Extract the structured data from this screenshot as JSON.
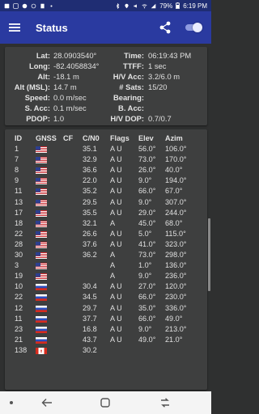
{
  "status_bar": {
    "battery": "79%",
    "time": "6:19 PM"
  },
  "app_bar": {
    "title": "Status"
  },
  "location": [
    {
      "l1": "Lat:",
      "v1": "28.0903540°",
      "l2": "Time:",
      "v2": "06:19:43 PM"
    },
    {
      "l1": "Long:",
      "v1": "-82.4058834°",
      "l2": "TTFF:",
      "v2": "1 sec"
    },
    {
      "l1": "Alt:",
      "v1": "-18.1 m",
      "l2": "H/V Acc:",
      "v2": "3.2/6.0 m"
    },
    {
      "l1": "Alt (MSL):",
      "v1": "14.7 m",
      "l2": "# Sats:",
      "v2": "15/20"
    },
    {
      "l1": "Speed:",
      "v1": "0.0 m/sec",
      "l2": "Bearing:",
      "v2": ""
    },
    {
      "l1": "S. Acc:",
      "v1": "0.1 m/sec",
      "l2": "B. Acc:",
      "v2": ""
    },
    {
      "l1": "PDOP:",
      "v1": "1.0",
      "l2": "H/V DOP:",
      "v2": "0.7/0.7"
    }
  ],
  "satellites": {
    "headers": {
      "id": "ID",
      "gnss": "GNSS",
      "cf": "CF",
      "cn0": "C/N0",
      "flags": "Flags",
      "elev": "Elev",
      "azim": "Azim"
    },
    "rows": [
      {
        "id": "1",
        "flag": "us",
        "cf": "",
        "cn0": "35.1",
        "flags": "A U",
        "elev": "56.0°",
        "azim": "106.0°"
      },
      {
        "id": "7",
        "flag": "us",
        "cf": "",
        "cn0": "32.9",
        "flags": "A U",
        "elev": "73.0°",
        "azim": "170.0°"
      },
      {
        "id": "8",
        "flag": "us",
        "cf": "",
        "cn0": "36.6",
        "flags": "A U",
        "elev": "26.0°",
        "azim": "40.0°"
      },
      {
        "id": "9",
        "flag": "us",
        "cf": "",
        "cn0": "22.0",
        "flags": "A U",
        "elev": "9.0°",
        "azim": "194.0°"
      },
      {
        "id": "11",
        "flag": "us",
        "cf": "",
        "cn0": "35.2",
        "flags": "A U",
        "elev": "66.0°",
        "azim": "67.0°"
      },
      {
        "id": "13",
        "flag": "us",
        "cf": "",
        "cn0": "29.5",
        "flags": "A U",
        "elev": "9.0°",
        "azim": "307.0°"
      },
      {
        "id": "17",
        "flag": "us",
        "cf": "",
        "cn0": "35.5",
        "flags": "A U",
        "elev": "29.0°",
        "azim": "244.0°"
      },
      {
        "id": "18",
        "flag": "us",
        "cf": "",
        "cn0": "32.1",
        "flags": "A",
        "elev": "45.0°",
        "azim": "68.0°"
      },
      {
        "id": "22",
        "flag": "us",
        "cf": "",
        "cn0": "26.6",
        "flags": "A U",
        "elev": "5.0°",
        "azim": "115.0°"
      },
      {
        "id": "28",
        "flag": "us",
        "cf": "",
        "cn0": "37.6",
        "flags": "A U",
        "elev": "41.0°",
        "azim": "323.0°"
      },
      {
        "id": "30",
        "flag": "us",
        "cf": "",
        "cn0": "36.2",
        "flags": "A",
        "elev": "73.0°",
        "azim": "298.0°"
      },
      {
        "id": "3",
        "flag": "us",
        "cf": "",
        "cn0": "",
        "flags": "A",
        "elev": "1.0°",
        "azim": "136.0°"
      },
      {
        "id": "19",
        "flag": "us",
        "cf": "",
        "cn0": "",
        "flags": "A",
        "elev": "9.0°",
        "azim": "236.0°"
      },
      {
        "id": "10",
        "flag": "ru",
        "cf": "",
        "cn0": "30.4",
        "flags": "A U",
        "elev": "27.0°",
        "azim": "120.0°"
      },
      {
        "id": "22",
        "flag": "ru",
        "cf": "",
        "cn0": "34.5",
        "flags": "A U",
        "elev": "66.0°",
        "azim": "230.0°"
      },
      {
        "id": "12",
        "flag": "ru",
        "cf": "",
        "cn0": "29.7",
        "flags": "A U",
        "elev": "35.0°",
        "azim": "336.0°"
      },
      {
        "id": "11",
        "flag": "ru",
        "cf": "",
        "cn0": "37.7",
        "flags": "A U",
        "elev": "66.0°",
        "azim": "49.0°"
      },
      {
        "id": "23",
        "flag": "ru",
        "cf": "",
        "cn0": "16.8",
        "flags": "A U",
        "elev": "9.0°",
        "azim": "213.0°"
      },
      {
        "id": "21",
        "flag": "ru",
        "cf": "",
        "cn0": "43.7",
        "flags": "A U",
        "elev": "49.0°",
        "azim": "21.0°"
      },
      {
        "id": "138",
        "flag": "ca",
        "cf": "",
        "cn0": "30.2",
        "flags": "",
        "elev": "",
        "azim": ""
      }
    ]
  },
  "colors": {
    "app_bar": "#2a3aa0",
    "status_bar": "#1f2d73",
    "background": "#2f3030",
    "card": "#3e3f3f"
  },
  "icons": [
    "menu-icon",
    "share-icon",
    "toggle-switch",
    "back-icon",
    "home-icon",
    "recents-icon"
  ]
}
